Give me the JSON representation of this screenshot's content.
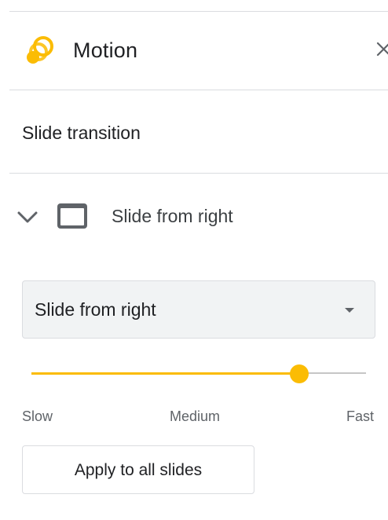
{
  "panel": {
    "title": "Motion",
    "close_icon": "close-icon",
    "motion_icon": "motion-icon",
    "accent_color": "#fbbc04"
  },
  "section": {
    "label": "Slide transition"
  },
  "transition": {
    "expand_icon": "chevron-down-icon",
    "thumb_icon": "slide-thumbnail-icon",
    "label": "Slide from right",
    "select_value": "Slide from right",
    "dropdown_icon": "dropdown-arrow-icon"
  },
  "speed": {
    "slow_label": "Slow",
    "medium_label": "Medium",
    "fast_label": "Fast",
    "value_fraction": 0.8
  },
  "actions": {
    "apply_label": "Apply to all slides"
  }
}
